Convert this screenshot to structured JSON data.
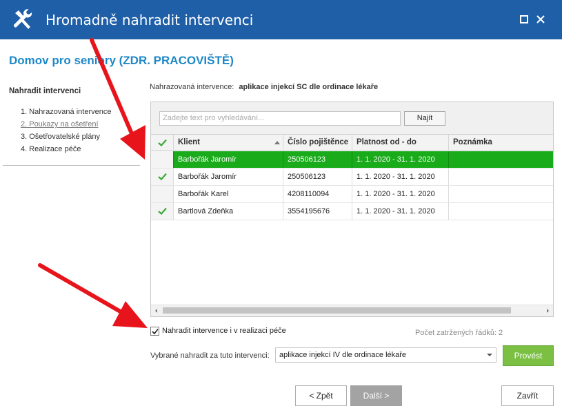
{
  "window": {
    "title": "Hromadně nahradit intervenci"
  },
  "facility_title": "Domov pro seniory (ZDR. PRACOVIŠTĚ)",
  "sidebar": {
    "heading": "Nahradit intervenci",
    "steps": [
      "1. Nahrazovaná intervence",
      "2. Poukazy na ošetření",
      "3. Ošetřovatelské plány",
      "4. Realizace péče"
    ],
    "active_step": 2
  },
  "replaced": {
    "label": "Nahrazovaná intervence:",
    "value": "aplikace injekcí SC dle ordinace lékaře"
  },
  "search": {
    "placeholder": "Zadejte text pro vyhledávání...",
    "button_label": "Najít"
  },
  "table": {
    "columns": [
      "Klient",
      "Číslo pojištěnce",
      "Platnost od - do",
      "Poznámka"
    ],
    "rows": [
      {
        "checked": false,
        "selected": true,
        "client": "Barbořák Jaromír",
        "insurance_no": "250506123",
        "validity": "1. 1. 2020 - 31. 1. 2020",
        "note": ""
      },
      {
        "checked": true,
        "selected": false,
        "client": "Barbořák Jaromír",
        "insurance_no": "250506123",
        "validity": "1. 1. 2020 - 31. 1. 2020",
        "note": ""
      },
      {
        "checked": false,
        "selected": false,
        "client": "Barbořák Karel",
        "insurance_no": "4208110094",
        "validity": "1. 1. 2020 - 31. 1. 2020",
        "note": ""
      },
      {
        "checked": true,
        "selected": false,
        "client": "Bartlová Zdeňka",
        "insurance_no": "3554195676",
        "validity": "1. 1. 2020 - 31. 1. 2020",
        "note": ""
      }
    ]
  },
  "replace_in_care": {
    "label": "Nahradit intervence i v realizaci péče",
    "checked": true
  },
  "checked_count_text": "Počet zatržených řádků: 2",
  "target": {
    "label": "Vybrané nahradit za tuto intervenci:",
    "selected_value": "aplikace injekcí IV dle ordinace lékaře"
  },
  "buttons": {
    "execute": "Provést",
    "back": "< Zpět",
    "next": "Další >",
    "close": "Zavřít"
  },
  "colors": {
    "titlebar": "#1f5fa8",
    "accent": "#1e88c8",
    "selected_row": "#1aab1a",
    "check": "#3aaa35",
    "execute_button": "#7bc043",
    "annotation_arrow": "#e8141b"
  }
}
